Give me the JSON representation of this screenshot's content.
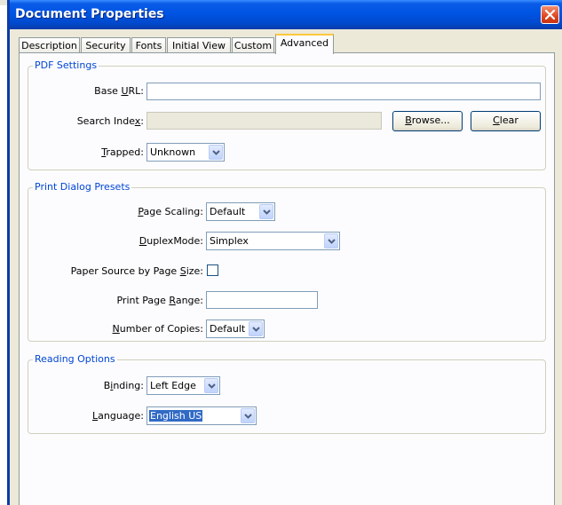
{
  "window": {
    "title": "Document Properties"
  },
  "tabs": [
    {
      "label": "Description"
    },
    {
      "label": "Security"
    },
    {
      "label": "Fonts"
    },
    {
      "label": "Initial View"
    },
    {
      "label": "Custom"
    },
    {
      "label": "Advanced",
      "active": true
    }
  ],
  "pdf_settings": {
    "legend": "PDF Settings",
    "base_url": {
      "label_pre": "Base ",
      "label_u": "U",
      "label_post": "RL:",
      "value": ""
    },
    "search_index": {
      "label_pre": "Search Inde",
      "label_u": "x",
      "label_post": ":",
      "value": ""
    },
    "browse_button": {
      "pre": "",
      "u": "B",
      "post": "rowse..."
    },
    "clear_button": {
      "pre": "",
      "u": "C",
      "post": "lear"
    },
    "trapped": {
      "label_pre": "",
      "label_u": "T",
      "label_post": "rapped:",
      "value": "Unknown"
    }
  },
  "print_presets": {
    "legend": "Print Dialog Presets",
    "page_scaling": {
      "label_pre": "",
      "label_u": "P",
      "label_post": "age Scaling:",
      "value": "Default"
    },
    "duplex_mode": {
      "label_pre": "",
      "label_u": "D",
      "label_post": "uplexMode:",
      "value": "Simplex"
    },
    "paper_source": {
      "label_pre": "Paper Source by Page ",
      "label_u": "S",
      "label_post": "ize:",
      "checked": false
    },
    "print_range": {
      "label_pre": "Print Page ",
      "label_u": "R",
      "label_post": "ange:",
      "value": ""
    },
    "num_copies": {
      "label_pre": "",
      "label_u": "N",
      "label_post": "umber of Copies:",
      "value": "Default"
    }
  },
  "reading_options": {
    "legend": "Reading Options",
    "binding": {
      "label_pre": "B",
      "label_u": "i",
      "label_post": "nding:",
      "value": "Left Edge"
    },
    "language": {
      "label_pre": "",
      "label_u": "L",
      "label_post": "anguage:",
      "value": "English US"
    }
  },
  "colors": {
    "title_bar": "#0054e3",
    "legend_text": "#0046d5",
    "close_button": "#e0461f",
    "selection": "#316ac5",
    "active_tab_accent": "#ffc83c"
  }
}
